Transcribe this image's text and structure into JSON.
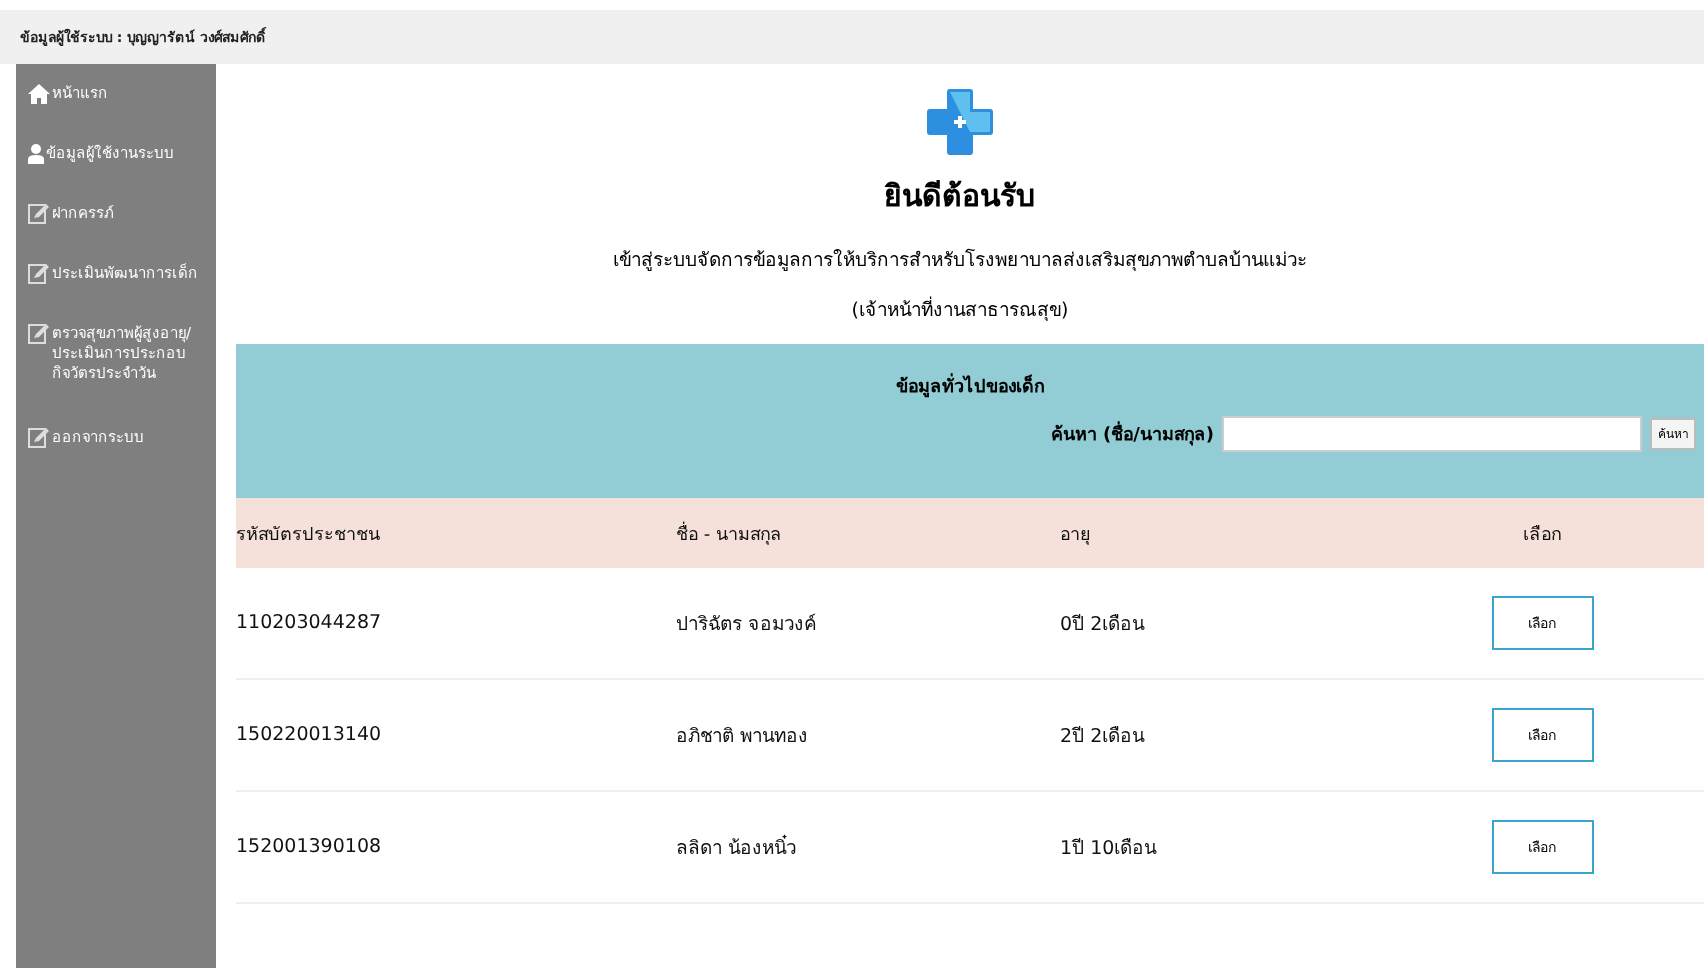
{
  "top_bar": {
    "user_label": "ข้อมูลผู้ใช้ระบบ : บุญญารัตน์ วงศ์สมศักดิ์"
  },
  "sidebar": {
    "items": [
      {
        "label": "หน้าแรก",
        "kind": "home"
      },
      {
        "label": "ข้อมูลผู้ใช้งานระบบ",
        "kind": "user"
      },
      {
        "label": "ฝากครรภ์",
        "kind": "edit"
      },
      {
        "label": "ประเมินพัฒนาการเด็ก",
        "kind": "edit"
      },
      {
        "label": "ตรวจสุขภาพผู้สูงอายุ/ประเมินการประกอบกิจวัตรประจำวัน",
        "kind": "edit"
      },
      {
        "label": "ออกจากระบบ",
        "kind": "edit"
      }
    ]
  },
  "header": {
    "title": "ยินดีต้อนรับ",
    "subtitle": "เข้าสู่ระบบจัดการข้อมูลการให้บริการสำหรับโรงพยาบาลส่งเสริมสุขภาพตำบลบ้านแม่วะ",
    "role": "(เจ้าหน้าที่งานสาธารณสุข)"
  },
  "panel": {
    "title": "ข้อมูลทั่วไปของเด็ก",
    "search_label": "ค้นหา (ชื่อ/นามสกุล)",
    "search_button": "ค้นหา"
  },
  "table": {
    "columns": [
      "รหัสบัตรประชาชน",
      "ชื่อ - นามสกุล",
      "อายุ",
      "เลือก"
    ],
    "rows": [
      {
        "id": "110203044287",
        "name": "ปาริฉัตร จอมวงค์",
        "age": "0ปี 2เดือน",
        "button": "เลือก"
      },
      {
        "id": "150220013140",
        "name": "อภิชาติ พานทอง",
        "age": "2ปี 2เดือน",
        "button": "เลือก"
      },
      {
        "id": "152001390108",
        "name": "ลลิดา น้องหนิ๋ว",
        "age": "1ปี 10เดือน",
        "button": "เลือก"
      }
    ]
  }
}
